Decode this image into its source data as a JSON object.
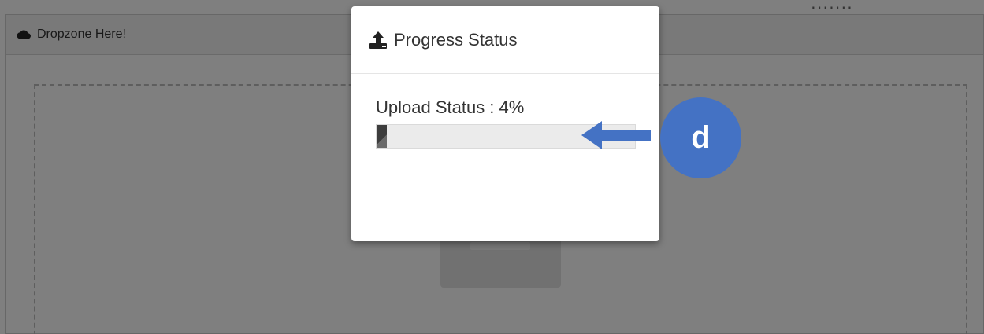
{
  "panel": {
    "header_title": "Dropzone Here!",
    "icon": "cloud-icon"
  },
  "modal": {
    "title": "Progress Status",
    "icon": "upload-icon",
    "status_text": "Upload Status : 4%",
    "progress_percent": 4
  },
  "annotation": {
    "badge_label": "d",
    "badge_color": "#4472c4",
    "arrow_icon": "arrow-left-icon"
  }
}
